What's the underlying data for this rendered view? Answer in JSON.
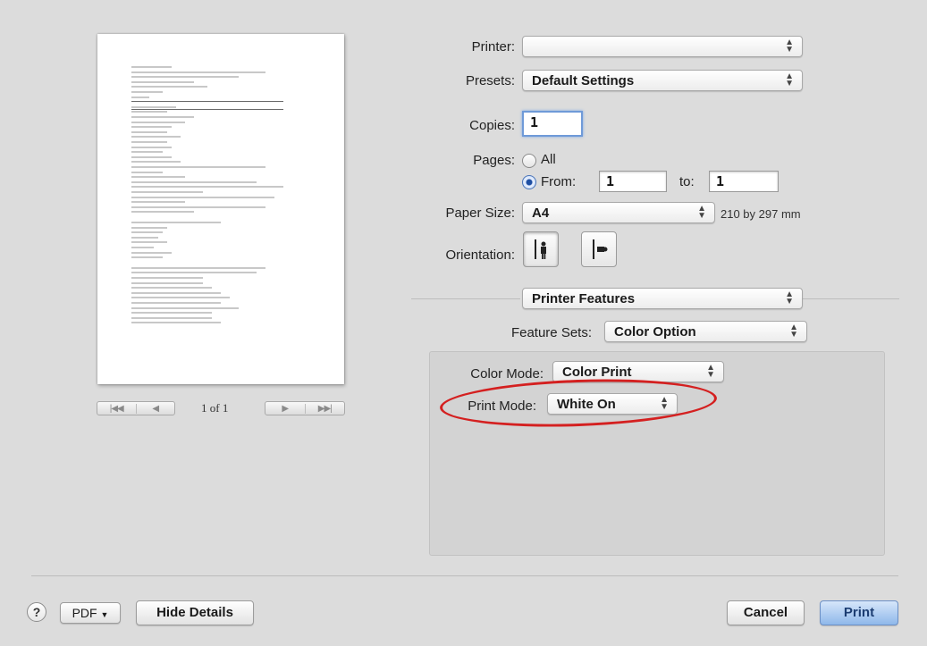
{
  "printer": {
    "label": "Printer:",
    "value": ""
  },
  "presets": {
    "label": "Presets:",
    "value": "Default Settings"
  },
  "copies": {
    "label": "Copies:",
    "value": "1"
  },
  "pages": {
    "label": "Pages:",
    "all_label": "All",
    "from_label": "From:",
    "from_value": "1",
    "to_label": "to:",
    "to_value": "1",
    "selected": "From"
  },
  "paper_size": {
    "label": "Paper Size:",
    "value": "A4",
    "dimensions": "210 by 297 mm"
  },
  "orientation": {
    "label": "Orientation:",
    "selected": "portrait"
  },
  "section_popup": {
    "value": "Printer Features"
  },
  "feature_sets": {
    "label": "Feature Sets:",
    "value": "Color Option"
  },
  "color_mode": {
    "label": "Color Mode:",
    "value": "Color Print"
  },
  "print_mode": {
    "label": "Print Mode:",
    "value": "White On",
    "highlight_color": "#d42020"
  },
  "preview": {
    "page_indicator": "1 of 1"
  },
  "footer": {
    "help_label": "?",
    "pdf_label": "PDF",
    "hide_details_label": "Hide Details",
    "cancel_label": "Cancel",
    "print_label": "Print"
  },
  "icons": {
    "popup_arrows": "up-down-arrows-icon",
    "first_page": "first-page-icon",
    "prev_page": "previous-page-icon",
    "next_page": "next-page-icon",
    "last_page": "last-page-icon",
    "portrait": "portrait-orientation-icon",
    "landscape": "landscape-orientation-icon"
  },
  "colors": {
    "default_button": "#8fb8ea",
    "radio_selected": "#1e4fa3"
  }
}
